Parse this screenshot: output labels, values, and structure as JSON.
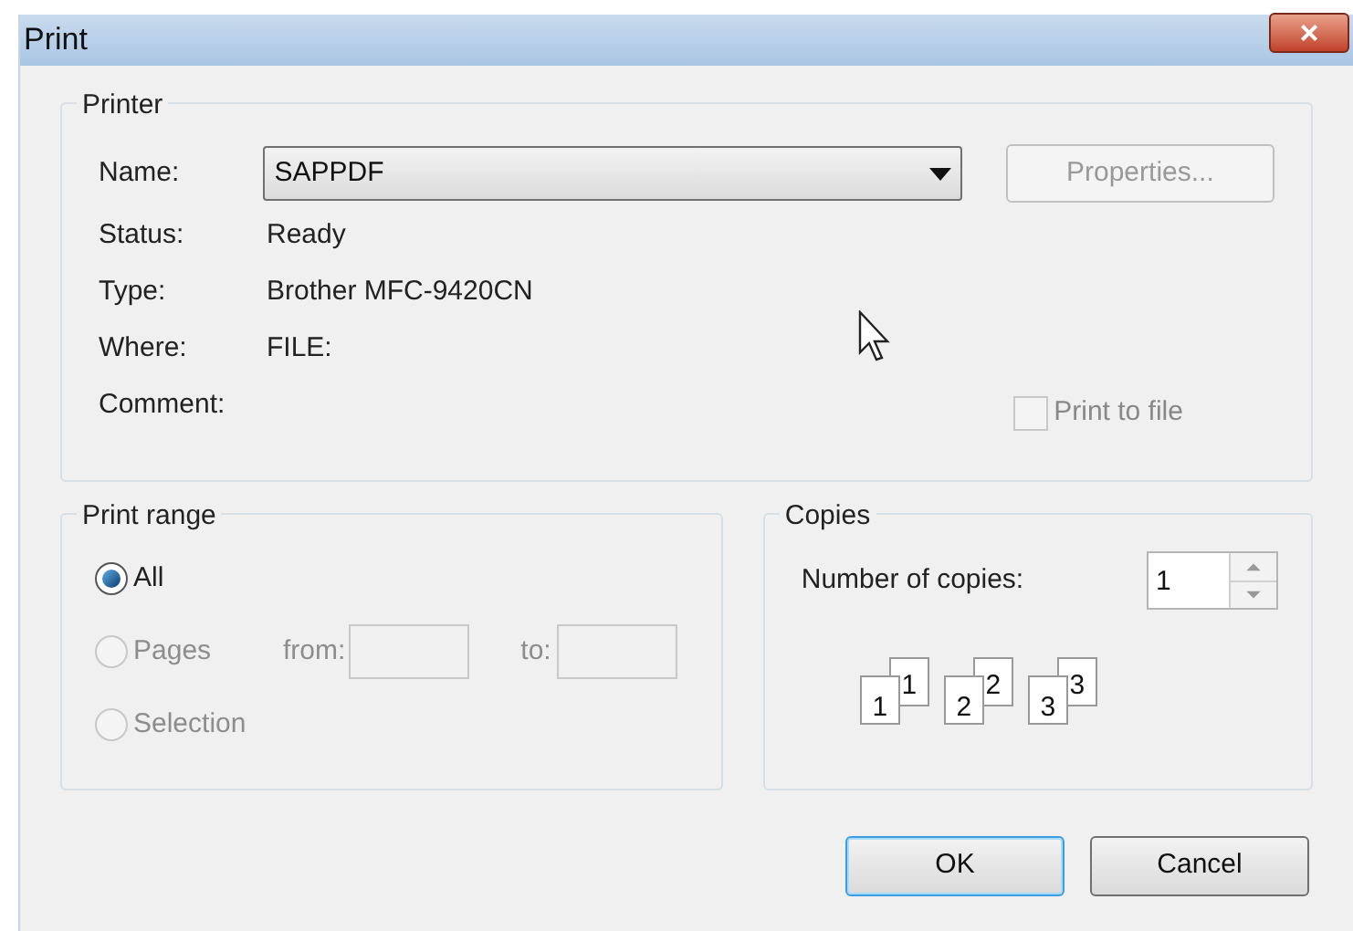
{
  "window": {
    "title": "Print",
    "close": "×"
  },
  "printer": {
    "legend": "Printer",
    "name_label": "Name:",
    "name_value": "SAPPDF",
    "properties_button": {
      "label": "Properties...",
      "disabled": true
    },
    "info": [
      {
        "label": "Status:",
        "value": "Ready"
      },
      {
        "label": "Type:",
        "value": "Brother MFC-9420CN"
      },
      {
        "label": "Where:",
        "value": "FILE:"
      },
      {
        "label": "Comment:"
      }
    ],
    "print_to_file": {
      "label": "Print to file",
      "checked": false,
      "disabled": true
    }
  },
  "print_range": {
    "legend": "Print range",
    "options": [
      {
        "label": "All",
        "selected": true,
        "disabled": false
      },
      {
        "label": "Pages",
        "selected": false,
        "disabled": true
      },
      {
        "label": "Selection",
        "selected": false,
        "disabled": true
      }
    ],
    "from_label": "from:",
    "to_label": "to:"
  },
  "copies": {
    "legend": "Copies",
    "number_label": "Number of copies:",
    "number_value": "1",
    "collate_pages": [
      {
        "back": "1",
        "front": "1"
      },
      {
        "back": "2",
        "front": "2"
      },
      {
        "back": "3",
        "front": "3"
      }
    ]
  },
  "buttons": [
    {
      "label": "OK",
      "default": true
    },
    {
      "label": "Cancel",
      "default": false
    }
  ]
}
